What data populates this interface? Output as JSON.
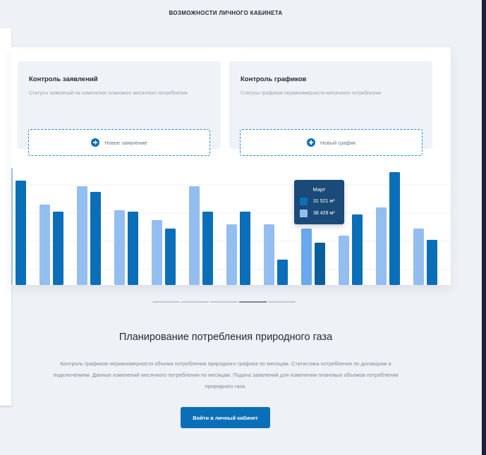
{
  "section": {
    "heading": "ВОЗМОЖНОСТИ ЛИЧНОГО КАБИНЕТА"
  },
  "panels": [
    {
      "title": "Контроль заявлений",
      "description": "Статусы заявлений на изменение планового месячного потребления",
      "button_label": "Новое заявление"
    },
    {
      "title": "Контроль графиков",
      "description": "Статусы графиков неравномерности месячного потребления",
      "button_label": "Новый график"
    }
  ],
  "chart_data": {
    "type": "bar",
    "series_colors": [
      "#94bdf0",
      "#0a6fb8"
    ],
    "highlight_colors": [
      "#6aa8f0",
      "#0a5e9c"
    ],
    "highlight_index": 8,
    "pairs": [
      [
        8.3,
        7.4
      ],
      [
        5.7,
        5.2
      ],
      [
        7.0,
        6.6
      ],
      [
        5.3,
        5.2
      ],
      [
        4.6,
        4.0
      ],
      [
        7.0,
        5.2
      ],
      [
        4.3,
        5.2
      ],
      [
        4.3,
        1.8
      ],
      [
        4.0,
        3.0
      ],
      [
        3.5,
        5.0
      ],
      [
        5.5,
        8.0
      ],
      [
        4.0,
        3.2
      ]
    ],
    "grid_lines": 4,
    "tooltip": {
      "title": "Март",
      "rows": [
        {
          "value": "31 521 м³",
          "color": "#0a6fb8"
        },
        {
          "value": "38 429 м³",
          "color": "#94bdf0"
        }
      ]
    }
  },
  "pager": {
    "count": 5,
    "active": 3
  },
  "promo": {
    "title": "Планирование потребления природного газа",
    "text": "Контроль графиков неравномерности объема потребления природного графика по месяцам. Статистика потребления по договорам и подключениям. Данные изменений месячного потребления по месяцам. Подача заявлений для изменения плановых объемов потребления природного газа.",
    "cta_label": "Войти в личный кабинет"
  }
}
